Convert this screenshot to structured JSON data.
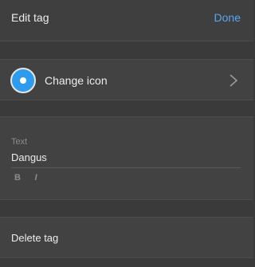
{
  "header": {
    "title": "Edit tag",
    "done_label": "Done"
  },
  "icon_row": {
    "label": "Change icon",
    "icon": "radio-circle-icon",
    "chevron": "chevron-right-icon",
    "icon_color": "#2e9bed"
  },
  "text_field": {
    "label": "Text",
    "value": "Dangus",
    "bold_label": "B",
    "italic_label": "I"
  },
  "delete_row": {
    "label": "Delete tag"
  },
  "colors": {
    "accent": "#5aa6ee",
    "background": "#3a3a3a",
    "panel": "#424242"
  }
}
